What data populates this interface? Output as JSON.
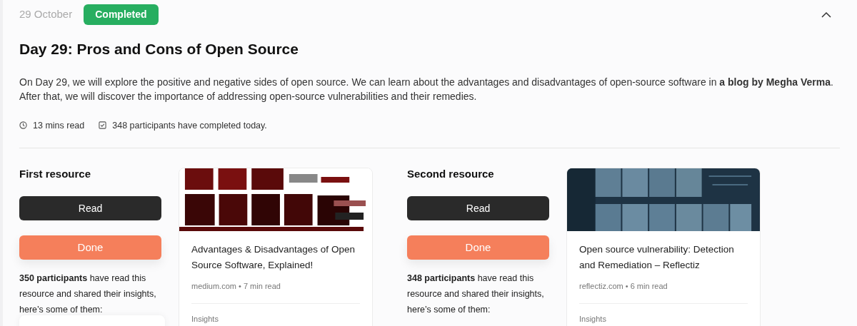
{
  "header": {
    "date": "29 October",
    "status": {
      "label": "Completed",
      "kind": "completed"
    },
    "expanded": true
  },
  "title": "Day 29: Pros and Cons of Open Source",
  "description": "On Day 29, we will explore the positive and negative sides of open source. We can learn about the advantages and disadvantages of open-source software in **a blog by Megha Verma**. After that, we will discover the importance of addressing open-source vulnerabilities and their remedies.",
  "meta": {
    "read_time": "13 mins read",
    "completed": "348 participants have completed today."
  },
  "resources": [
    {
      "heading": "First resource",
      "read_button": "Read",
      "done_button": "Done",
      "summary": "**350 participants** have read this resource and shared their insights, here’s some of them:",
      "insight_card": true,
      "card": {
        "title": "Advantages & Disadvantages of Open Source Software, Explained!",
        "source": "medium.com • 7 min read",
        "section": "Insights"
      }
    },
    {
      "heading": "Second resource",
      "read_button": "Read",
      "done_button": "Done",
      "summary": "**348 participants** have read this resource and shared their insights, here’s some of them:",
      "insight_card": false,
      "card": {
        "title": "Open source vulnerability: Detection and Remediation – Reflectiz",
        "source": "reflectiz.com • 6 min read",
        "section": "Insights"
      }
    }
  ]
}
